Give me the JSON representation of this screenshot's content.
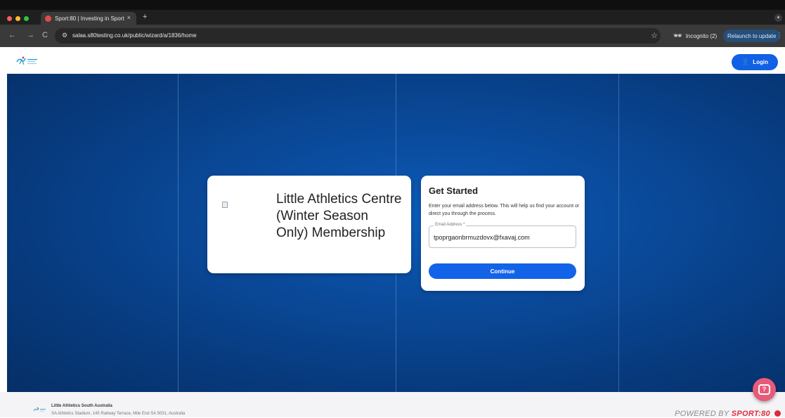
{
  "browser": {
    "tab_title": "Sport:80 | Investing in Sport",
    "tab_close": "×",
    "new_tab": "+",
    "url": "salaa.s80testing.co.uk/public/wizard/a/1836/home",
    "back": "←",
    "forward": "→",
    "reload": "C",
    "incognito_label": "Incognito (2)",
    "relaunch_label": "Relaunch to update",
    "icons": [
      "back-arrow-icon",
      "forward-arrow-icon",
      "reload-icon",
      "site-info-icon",
      "bookmark-star-icon",
      "incognito-icon",
      "menu-kebab-icon"
    ],
    "colors": {
      "traffic_red": "#ff5f57",
      "traffic_yellow": "#febc2e",
      "traffic_green": "#28c840"
    }
  },
  "header": {
    "login_label": "Login",
    "login_color": "#1160e6"
  },
  "program_card": {
    "title": "Little Athletics Centre (Winter Season Only) Membership"
  },
  "get_started": {
    "title": "Get Started",
    "description": "Enter your email address below. This will help us find your account or direct you through the process.",
    "email_label": "Email Address *",
    "email_value": "tpoprgaonbrmuzdovx@fxavaj.com",
    "continue_label": "Continue",
    "accent": "#1363e8"
  },
  "footer": {
    "org_name": "Little Athletics South Australia",
    "address": "SA Athletics Stadium, 145 Railway Terrace, Mile End SA 5031, Australia",
    "powered_prefix": "POWERED BY",
    "powered_brand": "SPORT:80"
  },
  "help_button": {
    "icon": "help-chat-icon"
  }
}
